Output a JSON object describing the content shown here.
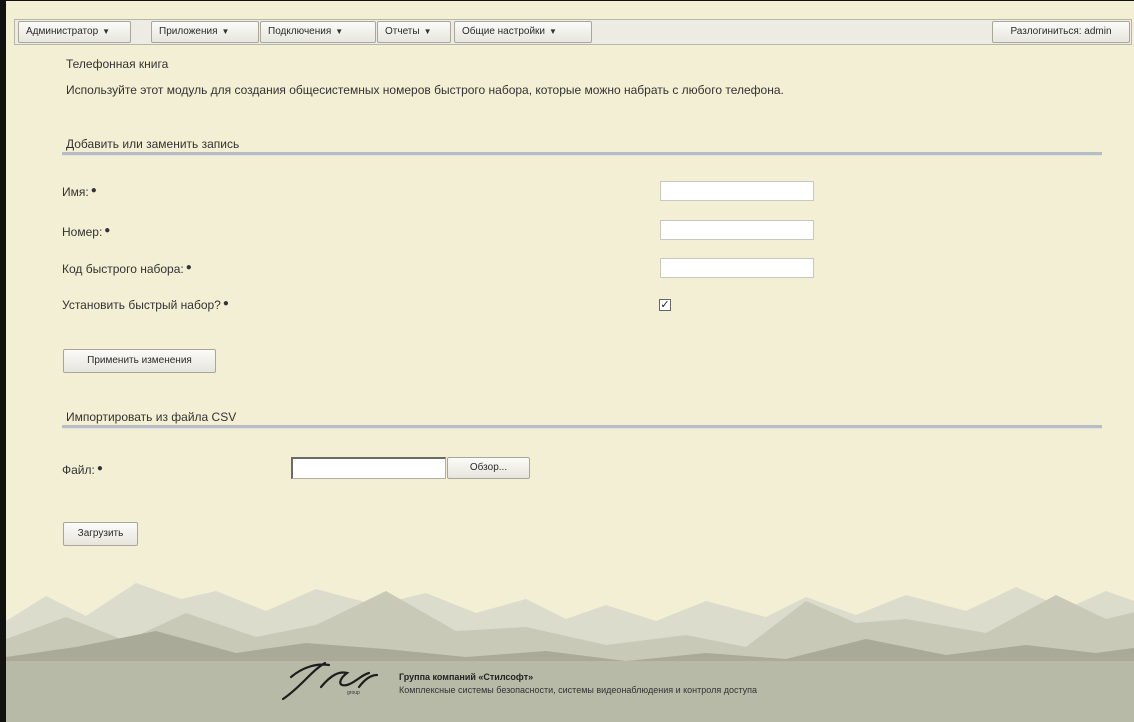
{
  "menu": {
    "items": [
      {
        "label": "Администратор"
      },
      {
        "label": "Приложения"
      },
      {
        "label": "Подключения"
      },
      {
        "label": "Отчеты"
      },
      {
        "label": "Общие настройки"
      }
    ],
    "logout": "Разлогиниться: admin"
  },
  "page": {
    "title": "Телефонная книга",
    "description": "Используйте этот модуль для создания общесистемных номеров быстрого набора, которые можно набрать с любого телефона."
  },
  "add_section": {
    "title": "Добавить или заменить запись",
    "fields": {
      "name": {
        "label": "Имя:",
        "value": ""
      },
      "number": {
        "label": "Номер:",
        "value": ""
      },
      "speed_code": {
        "label": "Код быстрого набора:",
        "value": ""
      },
      "set_speed_dial": {
        "label": "Установить быстрый набор?",
        "checked": true
      }
    },
    "apply_button": "Применить изменения"
  },
  "import_section": {
    "title": "Импортировать из файла CSV",
    "file_label": "Файл:",
    "browse_button": "Обзор...",
    "upload_button": "Загрузить"
  },
  "footer": {
    "company": "Группа компаний «Стилсофт»",
    "tagline": "Комплексные системы безопасности, системы видеонаблюдения и контроля доступа"
  },
  "required_marker": "●",
  "colors": {
    "page_background": "#f3efd4",
    "menu_background": "#ecebe4",
    "section_rule": "#b7bdc2",
    "mountains_back": "#dcdccd",
    "mountains_front": "#a9ab98"
  }
}
